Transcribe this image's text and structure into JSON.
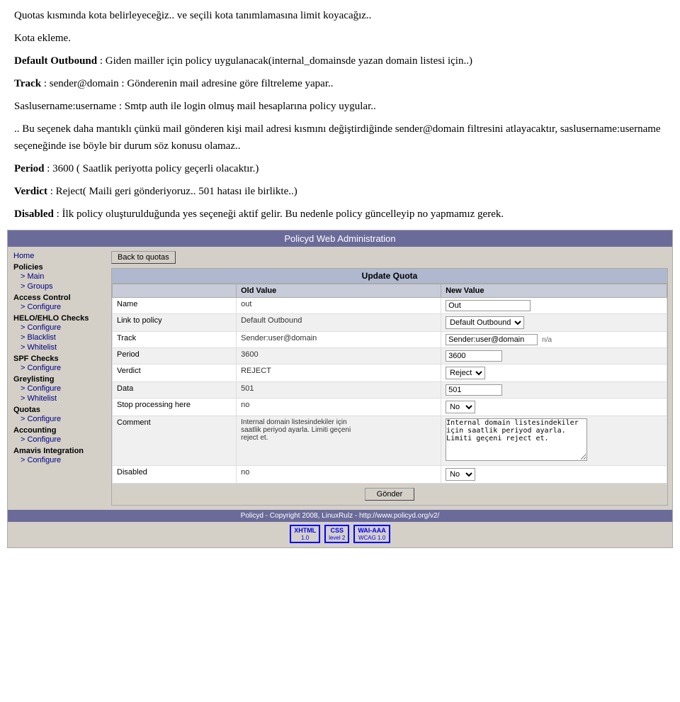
{
  "topText": {
    "line1": "Quotas kısmında kota belirleyeceğiz.. ve seçili kota tanımlamasına limit koyacağız..",
    "line2": "Kota ekleme.",
    "line3bold": "Default Outbound",
    "line3rest": " : Giden mailler için policy uygulanacak(internal_domainsde yazan domain listesi için..)",
    "line4bold": "Track",
    "line4rest": " : sender@domain : Gönderenin mail adresine göre filtreleme yapar..",
    "line5": "Saslusername:username : Smtp auth ile login olmuş mail hesaplarına policy uygular..",
    "line6": ".. Bu seçenek daha mantıklı çünkü mail gönderen kişi mail adresi kısmını değiştirdiğinde sender@domain filtresini atlayacaktır, saslusername:username seçeneğinde ise böyle bir durum söz konusu olamaz..",
    "line7bold": "Period",
    "line7rest": " : 3600 ( Saatlik periyotta policy geçerli olacaktır.)",
    "line8bold": "Verdict",
    "line8rest": " : Reject( Maili geri gönderiyoruz.. 501 hatası ile birlikte..)",
    "line9bold": "Disabled",
    "line9rest": " : İlk policy oluşturulduğunda yes seçeneği aktif gelir. Bu nedenle policy güncelleyip no yapmamız gerek."
  },
  "adminPanel": {
    "title": "Policyd Web Administration",
    "backButton": "Back to quotas",
    "updateQuotaTitle": "Update Quota",
    "tableHeaders": {
      "field": "",
      "oldValue": "Old Value",
      "newValue": "New Value"
    },
    "rows": [
      {
        "field": "Name",
        "oldValue": "out",
        "newValue": "Out",
        "inputType": "text",
        "inputValue": "Out"
      },
      {
        "field": "Link to policy",
        "oldValue": "Default Outbound",
        "newValue": "Default Outbound",
        "inputType": "select",
        "inputValue": "Default Outbound"
      },
      {
        "field": "Track",
        "oldValue": "Sender:user@domain",
        "newValue": "Sender:user@domain",
        "inputType": "text_na",
        "inputValue": "Sender:user@domain",
        "naLabel": "n/a"
      },
      {
        "field": "Period",
        "oldValue": "3600",
        "newValue": "3600",
        "inputType": "text",
        "inputValue": "3600"
      },
      {
        "field": "Verdict",
        "oldValue": "REJECT",
        "newValue": "Reject",
        "inputType": "select",
        "inputValue": "Reject"
      },
      {
        "field": "Data",
        "oldValue": "501",
        "newValue": "501",
        "inputType": "text",
        "inputValue": "501"
      },
      {
        "field": "Stop processing here",
        "oldValue": "no",
        "newValue": "No",
        "inputType": "select",
        "inputValue": "No"
      },
      {
        "field": "Comment",
        "oldValue": "Internal domain listesindekiler için saatlik periyod ayarla. Limiti geçeni reject et.",
        "newValueText": "Internal domain listesindekiler için saatlik periyod ayarla. Limiti geçeni reject et.",
        "inputType": "textarea"
      },
      {
        "field": "Disabled",
        "oldValue": "no",
        "newValue": "No",
        "inputType": "select",
        "inputValue": "No"
      }
    ],
    "submitButton": "Gönder",
    "footerText": "Policyd - Copyright 2008, LinuxRulz - http://www.policyd.org/v2/"
  },
  "sidebar": {
    "home": "Home",
    "policies": "Policies",
    "policiesMain": "Main",
    "policiesGroups": "Groups",
    "accessControl": "Access Control",
    "accessControlConfigure": "Configure",
    "heloChecks": "HELO/EHLO Checks",
    "heloConfigure": "Configure",
    "heloBlacklist": "Blacklist",
    "heloWhitelist": "Whitelist",
    "spfChecks": "SPF Checks",
    "spfConfigure": "Configure",
    "greylisting": "Greylisting",
    "greylistingConfigure": "Configure",
    "greylistingWhitelist": "Whitelist",
    "quotas": "Quotas",
    "quotasConfigure": "Configure",
    "accounting": "Accounting",
    "accountingConfigure": "Configure",
    "amavisIntegration": "Amavis Integration",
    "amavisConfigure": "Configure"
  },
  "badges": [
    {
      "id": "xhtml",
      "top": "XHTML",
      "bot": "1.0"
    },
    {
      "id": "css",
      "top": "CSS",
      "bot": "level 2"
    },
    {
      "id": "wai",
      "top": "WAI-AAA",
      "bot": "WCAG 1.0"
    }
  ]
}
